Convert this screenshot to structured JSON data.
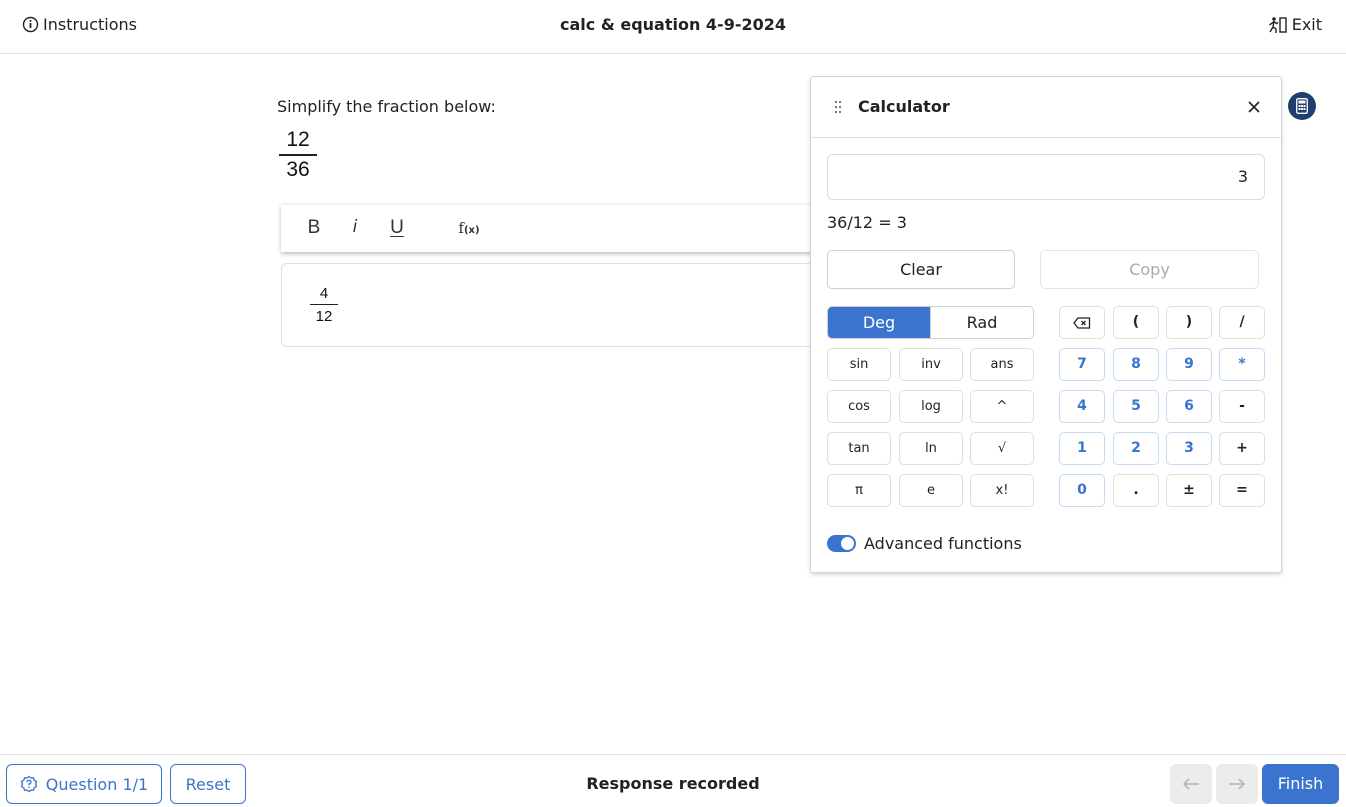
{
  "header": {
    "instructions_label": "Instructions",
    "title": "calc & equation 4-9-2024",
    "exit_label": "Exit"
  },
  "question": {
    "prompt": "Simplify the fraction below:",
    "fraction": {
      "numerator": "12",
      "denominator": "36"
    }
  },
  "editor": {
    "toolbar": {
      "bold_label": "B",
      "italic_label": "i",
      "underline_label": "U",
      "formula_label": "f",
      "formula_sub": "(x)"
    },
    "answer": {
      "numerator": "4",
      "denominator": "12"
    }
  },
  "calculator": {
    "title": "Calculator",
    "display_value": "3",
    "history": "36/12 = 3",
    "clear_label": "Clear",
    "copy_label": "Copy",
    "mode": {
      "deg_label": "Deg",
      "rad_label": "Rad",
      "selected": "Deg"
    },
    "function_keys": [
      [
        "sin",
        "inv",
        "ans"
      ],
      [
        "cos",
        "log",
        "^"
      ],
      [
        "tan",
        "ln",
        "√"
      ],
      [
        "π",
        "e",
        "x!"
      ]
    ],
    "top_keys": [
      "(",
      ")",
      "/"
    ],
    "number_rows": [
      [
        "7",
        "8",
        "9",
        "*"
      ],
      [
        "4",
        "5",
        "6",
        "-"
      ],
      [
        "1",
        "2",
        "3",
        "+"
      ],
      [
        "0",
        ".",
        "±",
        "="
      ]
    ],
    "advanced_label": "Advanced functions",
    "advanced_enabled": true,
    "accent_color": "#3b74cf"
  },
  "footer": {
    "question_label": "Question 1/1",
    "reset_label": "Reset",
    "status": "Response recorded",
    "finish_label": "Finish"
  }
}
